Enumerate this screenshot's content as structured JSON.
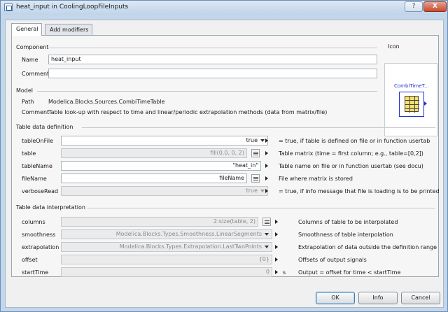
{
  "window": {
    "title": "heat_input in CoolingLoopFileInputs",
    "help_label": "?",
    "close_label": "X"
  },
  "tabs": [
    "General",
    "Add modifiers"
  ],
  "component": {
    "heading": "Component",
    "name_label": "Name",
    "name_value": "heat_input",
    "comment_label": "Comment",
    "comment_value": ""
  },
  "icon_box": {
    "heading": "Icon",
    "icon_name": "CombiTimeT..."
  },
  "model": {
    "heading": "Model",
    "path_label": "Path",
    "path_value": "Modelica.Blocks.Sources.CombiTimeTable",
    "comment_label": "Comment",
    "comment_value": "Table look-up with respect to time and linear/periodic extrapolation methods (data from matrix/file)"
  },
  "table_definition": {
    "heading": "Table data definition",
    "rows": [
      {
        "label": "tableOnFile",
        "value": "true",
        "description": "= true, if table is defined on file or in function usertab"
      },
      {
        "label": "table",
        "value": "fill(0.0, 0, 2)",
        "description": "Table matrix (time = first column; e.g., table=[0,2])"
      },
      {
        "label": "tableName",
        "value": "\"heat_in\"",
        "description": "Table name on file or in function usertab (see docu)"
      },
      {
        "label": "fileName",
        "value": "fileName",
        "description": "File where matrix is stored"
      },
      {
        "label": "verboseRead",
        "value": "true",
        "description": "= true, if info message that file is loading is to be printed"
      }
    ]
  },
  "table_interpretation": {
    "heading": "Table data interpretation",
    "rows": [
      {
        "label": "columns",
        "value": "2:size(table, 2)",
        "unit": "",
        "description": "Columns of table to be interpolated"
      },
      {
        "label": "smoothness",
        "value": "Modelica.Blocks.Types.Smoothness.LinearSegments",
        "unit": "",
        "description": "Smoothness of table interpolation"
      },
      {
        "label": "extrapolation",
        "value": "Modelica.Blocks.Types.Extrapolation.LastTwoPoints",
        "unit": "",
        "description": "Extrapolation of data outside the definition range"
      },
      {
        "label": "offset",
        "value": "{0}",
        "unit": "",
        "description": "Offsets of output signals"
      },
      {
        "label": "startTime",
        "value": "0",
        "unit": "s",
        "description": "Output = offset for time < startTime"
      }
    ]
  },
  "buttons": {
    "ok": "OK",
    "info": "Info",
    "cancel": "Cancel"
  },
  "colors": {
    "icon_blue": "#2233cc",
    "table_yellow": "#f6e06a",
    "window_frame": "#c3d6ea"
  }
}
